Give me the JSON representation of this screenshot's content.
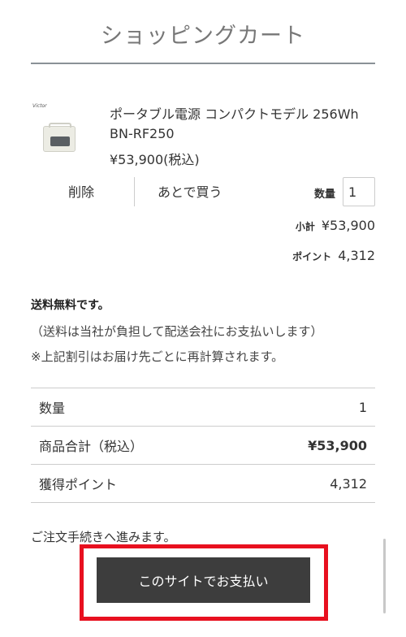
{
  "header": {
    "title": "ショッピングカート"
  },
  "cart_item": {
    "brand_logo_text": "Victor",
    "name": "ポータブル電源 コンパクトモデル 256Wh BN-RF250",
    "price": "¥53,900(税込)",
    "delete_label": "削除",
    "save_for_later_label": "あとで買う",
    "quantity_label": "数量",
    "quantity_value": "1",
    "subtotal_label": "小計",
    "subtotal_value": "¥53,900",
    "points_label": "ポイント",
    "points_value": "4,312"
  },
  "shipping": {
    "free_label": "送料無料です。",
    "note1": "（送料は当社が負担して配送会社にお支払いします）",
    "note2": "※上記割引はお届け先ごとに再計算されます。"
  },
  "summary": {
    "rows": [
      {
        "label": "数量",
        "value": "1"
      },
      {
        "label": "商品合計（税込）",
        "value": "¥53,900"
      },
      {
        "label": "獲得ポイント",
        "value": "4,312"
      }
    ]
  },
  "checkout": {
    "proceed_text": "ご注文手続きへ進みます。",
    "pay_button_label": "このサイトでお支払い",
    "highlight_color": "#e8101f",
    "button_color": "#3d3d3d"
  }
}
